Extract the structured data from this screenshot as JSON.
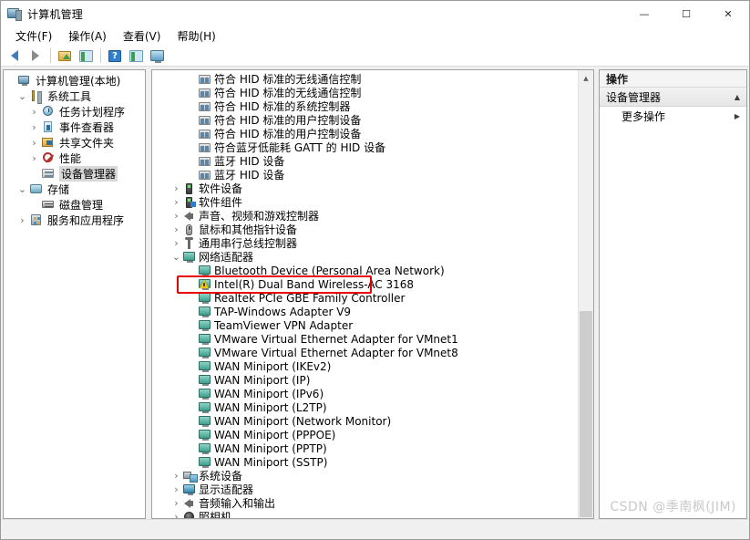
{
  "window": {
    "title": "计算机管理",
    "icon": "computer-management-icon",
    "minimize_label": "—",
    "maximize_label": "☐",
    "close_label": "✕"
  },
  "menubar": {
    "items": [
      {
        "label": "文件(F)",
        "name": "menu-file"
      },
      {
        "label": "操作(A)",
        "name": "menu-action"
      },
      {
        "label": "查看(V)",
        "name": "menu-view"
      },
      {
        "label": "帮助(H)",
        "name": "menu-help"
      }
    ]
  },
  "toolbar": {
    "buttons": [
      {
        "name": "back-button",
        "icon": "arrow-left-icon"
      },
      {
        "name": "forward-button",
        "icon": "arrow-right-icon"
      },
      {
        "name": "up-one-level-button",
        "icon": "folder-up-icon"
      },
      {
        "name": "show-hide-console-tree-button",
        "icon": "console-tree-icon"
      },
      {
        "name": "help-button",
        "icon": "help-icon"
      },
      {
        "name": "properties-button",
        "icon": "properties-icon"
      },
      {
        "name": "display-button",
        "icon": "monitor-icon"
      }
    ]
  },
  "tree": {
    "items": [
      {
        "label": "计算机管理(本地)",
        "indent": 0,
        "twist": "",
        "icon": "computer-icon",
        "selected": false,
        "name": "tree-item-computer-management-local"
      },
      {
        "label": "系统工具",
        "indent": 1,
        "twist": "v",
        "icon": "system-tools-icon",
        "selected": false,
        "name": "tree-item-system-tools"
      },
      {
        "label": "任务计划程序",
        "indent": 2,
        "twist": ">",
        "icon": "task-scheduler-icon",
        "selected": false,
        "name": "tree-item-task-scheduler"
      },
      {
        "label": "事件查看器",
        "indent": 2,
        "twist": ">",
        "icon": "event-viewer-icon",
        "selected": false,
        "name": "tree-item-event-viewer"
      },
      {
        "label": "共享文件夹",
        "indent": 2,
        "twist": ">",
        "icon": "shared-folders-icon",
        "selected": false,
        "name": "tree-item-shared-folders"
      },
      {
        "label": "性能",
        "indent": 2,
        "twist": ">",
        "icon": "performance-icon",
        "selected": false,
        "name": "tree-item-performance"
      },
      {
        "label": "设备管理器",
        "indent": 2,
        "twist": "",
        "icon": "device-manager-icon",
        "selected": true,
        "name": "tree-item-device-manager"
      },
      {
        "label": "存储",
        "indent": 1,
        "twist": "v",
        "icon": "storage-icon",
        "selected": false,
        "name": "tree-item-storage"
      },
      {
        "label": "磁盘管理",
        "indent": 2,
        "twist": "",
        "icon": "disk-management-icon",
        "selected": false,
        "name": "tree-item-disk-management"
      },
      {
        "label": "服务和应用程序",
        "indent": 1,
        "twist": ">",
        "icon": "services-apps-icon",
        "selected": false,
        "name": "tree-item-services-and-applications"
      }
    ]
  },
  "devicelist": {
    "items": [
      {
        "label": "符合 HID 标准的无线通信控制",
        "indent": 2,
        "twist": "",
        "icon": "hid-device-icon",
        "warning": false,
        "name": "device-hid-wireless-controller-1"
      },
      {
        "label": "符合 HID 标准的无线通信控制",
        "indent": 2,
        "twist": "",
        "icon": "hid-device-icon",
        "warning": false,
        "name": "device-hid-wireless-controller-2"
      },
      {
        "label": "符合 HID 标准的系统控制器",
        "indent": 2,
        "twist": "",
        "icon": "hid-device-icon",
        "warning": false,
        "name": "device-hid-system-controller"
      },
      {
        "label": "符合 HID 标准的用户控制设备",
        "indent": 2,
        "twist": "",
        "icon": "hid-device-icon",
        "warning": false,
        "name": "device-hid-consumer-control-1"
      },
      {
        "label": "符合 HID 标准的用户控制设备",
        "indent": 2,
        "twist": "",
        "icon": "hid-device-icon",
        "warning": false,
        "name": "device-hid-consumer-control-2"
      },
      {
        "label": "符合蓝牙低能耗 GATT 的 HID 设备",
        "indent": 2,
        "twist": "",
        "icon": "hid-device-icon",
        "warning": false,
        "name": "device-ble-gatt-hid"
      },
      {
        "label": "蓝牙 HID 设备",
        "indent": 2,
        "twist": "",
        "icon": "hid-device-icon",
        "warning": false,
        "name": "device-bluetooth-hid-1"
      },
      {
        "label": "蓝牙 HID 设备",
        "indent": 2,
        "twist": "",
        "icon": "hid-device-icon",
        "warning": false,
        "name": "device-bluetooth-hid-2"
      },
      {
        "label": "软件设备",
        "indent": 1,
        "twist": ">",
        "icon": "software-device-icon",
        "warning": false,
        "name": "category-software-devices"
      },
      {
        "label": "软件组件",
        "indent": 1,
        "twist": ">",
        "icon": "software-component-icon",
        "warning": false,
        "name": "category-software-components"
      },
      {
        "label": "声音、视频和游戏控制器",
        "indent": 1,
        "twist": ">",
        "icon": "speaker-icon",
        "warning": false,
        "name": "category-sound-video-game-controllers"
      },
      {
        "label": "鼠标和其他指针设备",
        "indent": 1,
        "twist": ">",
        "icon": "mouse-icon",
        "warning": false,
        "name": "category-mice-and-pointing-devices"
      },
      {
        "label": "通用串行总线控制器",
        "indent": 1,
        "twist": ">",
        "icon": "usb-icon",
        "warning": false,
        "name": "category-usb-controllers"
      },
      {
        "label": "网络适配器",
        "indent": 1,
        "twist": "v",
        "icon": "network-adapter-icon",
        "warning": false,
        "name": "category-network-adapters"
      },
      {
        "label": "Bluetooth Device (Personal Area Network)",
        "indent": 2,
        "twist": "",
        "icon": "network-adapter-icon",
        "warning": false,
        "name": "device-bluetooth-pan"
      },
      {
        "label": "Intel(R) Dual Band Wireless-AC 3168",
        "indent": 2,
        "twist": "",
        "icon": "network-adapter-icon",
        "warning": true,
        "name": "device-intel-dual-band-wireless-ac-3168"
      },
      {
        "label": "Realtek PCIe GBE Family Controller",
        "indent": 2,
        "twist": "",
        "icon": "network-adapter-icon",
        "warning": false,
        "name": "device-realtek-pcie-gbe"
      },
      {
        "label": "TAP-Windows Adapter V9",
        "indent": 2,
        "twist": "",
        "icon": "network-adapter-icon",
        "warning": false,
        "name": "device-tap-windows-adapter-v9"
      },
      {
        "label": "TeamViewer VPN Adapter",
        "indent": 2,
        "twist": "",
        "icon": "network-adapter-icon",
        "warning": false,
        "name": "device-teamviewer-vpn-adapter"
      },
      {
        "label": "VMware Virtual Ethernet Adapter for VMnet1",
        "indent": 2,
        "twist": "",
        "icon": "network-adapter-icon",
        "warning": false,
        "name": "device-vmware-vmnet1"
      },
      {
        "label": "VMware Virtual Ethernet Adapter for VMnet8",
        "indent": 2,
        "twist": "",
        "icon": "network-adapter-icon",
        "warning": false,
        "name": "device-vmware-vmnet8"
      },
      {
        "label": "WAN Miniport (IKEv2)",
        "indent": 2,
        "twist": "",
        "icon": "network-adapter-icon",
        "warning": false,
        "name": "device-wan-miniport-ikev2"
      },
      {
        "label": "WAN Miniport (IP)",
        "indent": 2,
        "twist": "",
        "icon": "network-adapter-icon",
        "warning": false,
        "name": "device-wan-miniport-ip"
      },
      {
        "label": "WAN Miniport (IPv6)",
        "indent": 2,
        "twist": "",
        "icon": "network-adapter-icon",
        "warning": false,
        "name": "device-wan-miniport-ipv6"
      },
      {
        "label": "WAN Miniport (L2TP)",
        "indent": 2,
        "twist": "",
        "icon": "network-adapter-icon",
        "warning": false,
        "name": "device-wan-miniport-l2tp"
      },
      {
        "label": "WAN Miniport (Network Monitor)",
        "indent": 2,
        "twist": "",
        "icon": "network-adapter-icon",
        "warning": false,
        "name": "device-wan-miniport-network-monitor"
      },
      {
        "label": "WAN Miniport (PPPOE)",
        "indent": 2,
        "twist": "",
        "icon": "network-adapter-icon",
        "warning": false,
        "name": "device-wan-miniport-pppoe"
      },
      {
        "label": "WAN Miniport (PPTP)",
        "indent": 2,
        "twist": "",
        "icon": "network-adapter-icon",
        "warning": false,
        "name": "device-wan-miniport-pptp"
      },
      {
        "label": "WAN Miniport (SSTP)",
        "indent": 2,
        "twist": "",
        "icon": "network-adapter-icon",
        "warning": false,
        "name": "device-wan-miniport-sstp"
      },
      {
        "label": "系统设备",
        "indent": 1,
        "twist": ">",
        "icon": "system-devices-icon",
        "warning": false,
        "name": "category-system-devices"
      },
      {
        "label": "显示适配器",
        "indent": 1,
        "twist": ">",
        "icon": "display-adapter-icon",
        "warning": false,
        "name": "category-display-adapters"
      },
      {
        "label": "音频输入和输出",
        "indent": 1,
        "twist": ">",
        "icon": "audio-io-icon",
        "warning": false,
        "name": "category-audio-inputs-and-outputs"
      },
      {
        "label": "照相机",
        "indent": 1,
        "twist": ">",
        "icon": "camera-icon",
        "warning": false,
        "name": "category-cameras"
      }
    ],
    "scrollbar": {
      "up_arrow": "▲",
      "down_arrow": "▼"
    }
  },
  "actions": {
    "header": "操作",
    "group_label": "设备管理器",
    "group_chevron": "▲",
    "items": [
      {
        "label": "更多操作",
        "arrow": "▶",
        "name": "action-more-actions"
      }
    ]
  },
  "annotation": {
    "highlight_color": "#e60000",
    "target": "Intel(R) Dual Band Wireless-AC 3168"
  },
  "watermark": {
    "text": "CSDN @季南枫(JIM)"
  }
}
